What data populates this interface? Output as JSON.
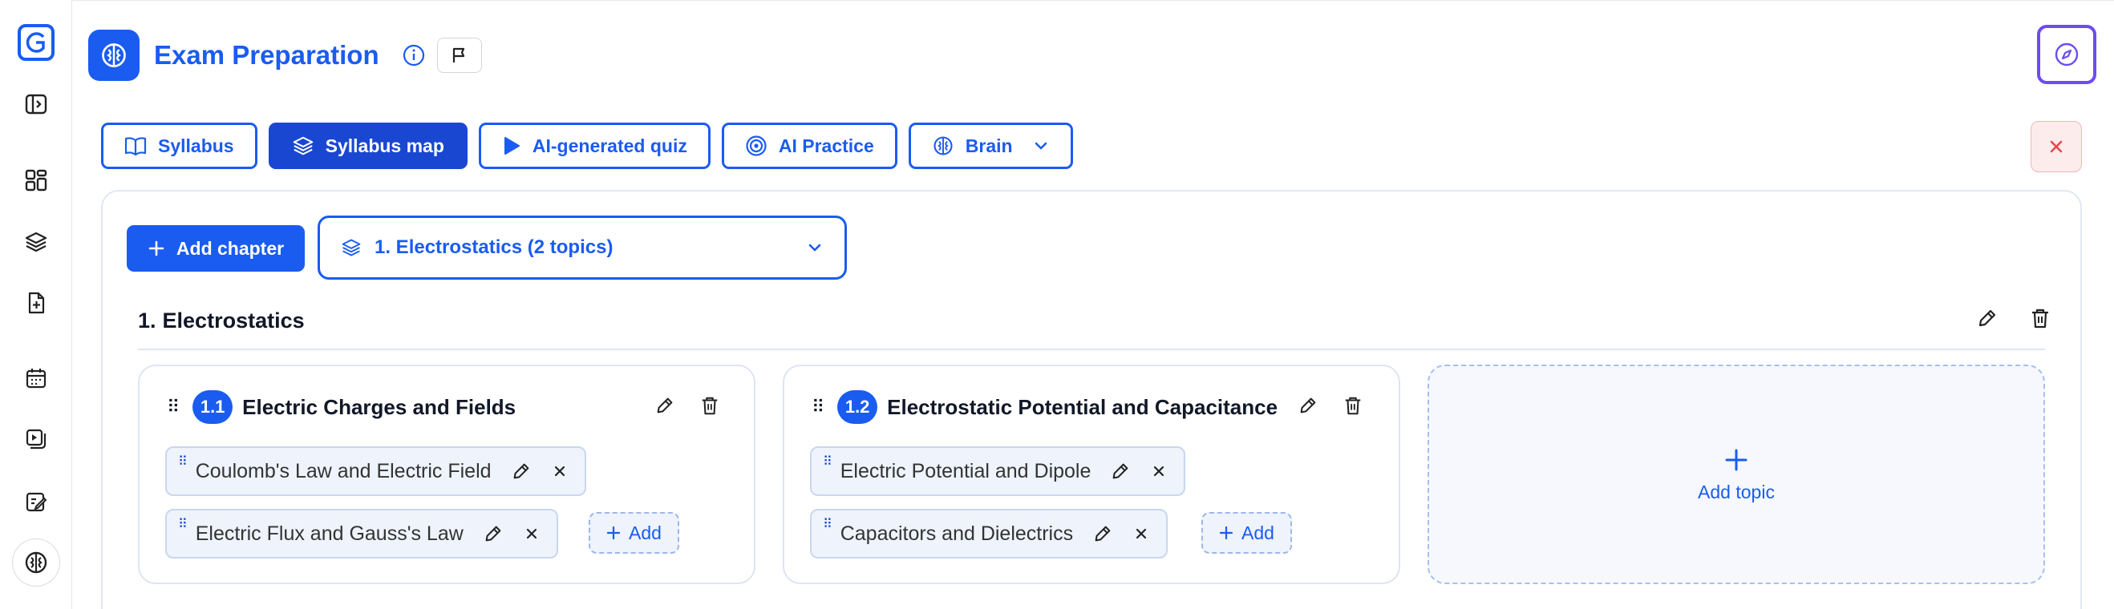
{
  "header": {
    "title": "Exam Preparation"
  },
  "tabs": [
    {
      "label": "Syllabus",
      "icon": "book-icon"
    },
    {
      "label": "Syllabus map",
      "icon": "layers-icon",
      "active": true
    },
    {
      "label": "AI-generated quiz",
      "icon": "play-icon"
    },
    {
      "label": "AI Practice",
      "icon": "target-icon"
    },
    {
      "label": "Brain",
      "icon": "brain-icon"
    }
  ],
  "toolbar": {
    "add_chapter_label": "Add chapter",
    "chapter_select_value": "1. Electrostatics (2 topics)"
  },
  "chapter": {
    "number": "1.",
    "title": "Electrostatics"
  },
  "topics": [
    {
      "number": "1.1",
      "title": "Electric Charges and Fields",
      "subtopics": [
        "Coulomb's Law and Electric Field",
        "Electric Flux and Gauss's Law"
      ],
      "add_label": "Add"
    },
    {
      "number": "1.2",
      "title": "Electrostatic Potential and Capacitance",
      "subtopics": [
        "Electric Potential and Dipole",
        "Capacitors and Dielectrics"
      ],
      "add_label": "Add"
    }
  ],
  "add_topic_label": "Add topic",
  "colors": {
    "primary": "#1a5cf0",
    "active_tab": "#1a47d1",
    "accent_purple": "#6d4cf0",
    "danger": "#e5484d"
  }
}
